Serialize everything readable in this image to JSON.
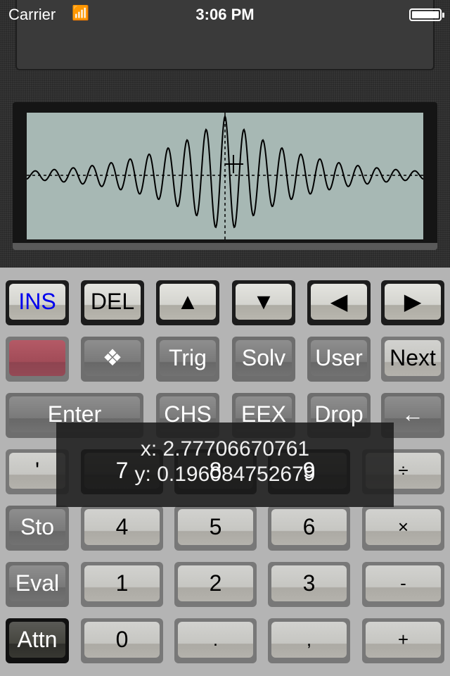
{
  "status_bar": {
    "carrier": "Carrier",
    "time": "3:06 PM",
    "wifi_icon": "wifi-icon",
    "battery_level": 1.0
  },
  "graph": {
    "function_shape": "damped oscillation centered at origin",
    "axes": "dashed",
    "cursor": "crosshair"
  },
  "keys": {
    "row1": [
      "INS",
      "DEL",
      "▲",
      "▼",
      "◀",
      "▶"
    ],
    "row2": [
      "",
      "❖",
      "Trig",
      "Solv",
      "User",
      "Next"
    ],
    "row3": [
      "Enter",
      "CHS",
      "EEX",
      "Drop",
      "←"
    ],
    "row4": [
      "'",
      "7",
      "8",
      "9",
      "÷"
    ],
    "row5": [
      "Sto",
      "4",
      "5",
      "6",
      "×"
    ],
    "row6": [
      "Eval",
      "1",
      "2",
      "3",
      "-"
    ],
    "row7": [
      "Attn",
      "0",
      ".",
      ",",
      "+"
    ]
  },
  "colors": {
    "ins_label": "#0000ee",
    "shift_key": "#a24c58",
    "lcd": "#a7b8b4"
  },
  "coordinate_readout": {
    "x": "x: 2.77706670761",
    "y": "y: 0.196084752679"
  }
}
